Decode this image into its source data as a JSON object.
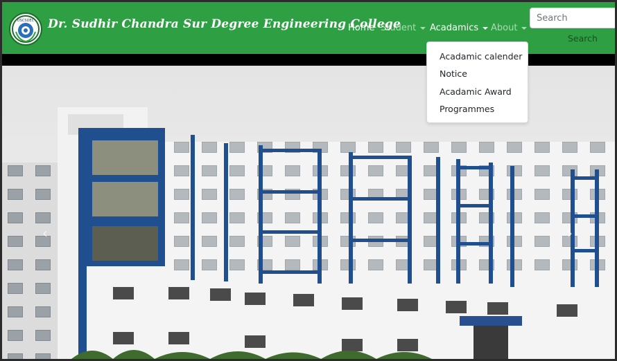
{
  "brand": {
    "logo_icon": "college-seal-icon",
    "logo_text": "DSCSDEC",
    "name": "Dr. Sudhir Chandra Sur Degree Engineering College"
  },
  "nav": {
    "items": [
      {
        "label": "Home",
        "dropdown": false
      },
      {
        "label": "Student",
        "dropdown": true
      },
      {
        "label": "Acadamics",
        "dropdown": true
      },
      {
        "label": "About",
        "dropdown": true
      }
    ],
    "active": "Acadamics"
  },
  "search": {
    "placeholder": "Search",
    "button_label": "Search"
  },
  "acadamics_dropdown": {
    "items": [
      "Acadamic calender",
      "Notice",
      "Acadamic Award",
      "Programmes"
    ]
  },
  "carousel": {
    "image": "college-building-photo",
    "prev_icon": "chevron-left-icon",
    "next_icon": "chevron-right-icon",
    "prev_symbol": "‹",
    "next_symbol": "›"
  },
  "colors": {
    "navbar": "#2ea043",
    "building_trim": "#1f4f8f",
    "building_wall": "#f4f4f4"
  }
}
